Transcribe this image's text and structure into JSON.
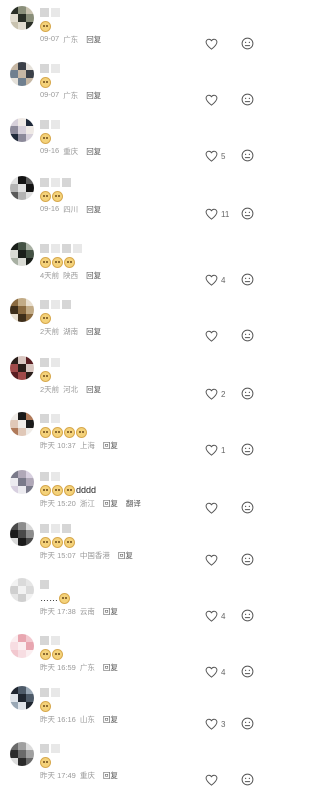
{
  "labels": {
    "reply": "回复",
    "translate": "翻译"
  },
  "colors": {
    "background": "#ffffff",
    "meta": "#9a9a9a",
    "emoji": "#f4d27a"
  },
  "icons": {
    "like": "heart-outline-icon",
    "dislike": "unhappy-face-icon"
  },
  "comments": [
    {
      "content": "",
      "emojis": 1,
      "time": "09-07",
      "location": "广东",
      "likes": "",
      "translate": false
    },
    {
      "content": "",
      "emojis": 1,
      "time": "09-07",
      "location": "广东",
      "likes": "",
      "translate": false
    },
    {
      "content": "",
      "emojis": 1,
      "time": "09-16",
      "location": "重庆",
      "likes": "5",
      "translate": false
    },
    {
      "content": "",
      "emojis": 2,
      "time": "09-16",
      "location": "四川",
      "likes": "11",
      "translate": false
    },
    {
      "content": "",
      "emojis": 3,
      "time": "4天前",
      "location": "陕西",
      "likes": "4",
      "translate": false
    },
    {
      "content": "",
      "emojis": 1,
      "time": "2天前",
      "location": "湖南",
      "likes": "",
      "translate": false
    },
    {
      "content": "",
      "emojis": 1,
      "time": "2天前",
      "location": "河北",
      "likes": "2",
      "translate": false
    },
    {
      "content": "",
      "emojis": 4,
      "time": "昨天 10:37",
      "location": "上海",
      "likes": "1",
      "translate": false
    },
    {
      "content": "dddd",
      "emojis": 3,
      "time": "昨天 15:20",
      "location": "浙江",
      "likes": "",
      "translate": true
    },
    {
      "content": "",
      "emojis": 3,
      "time": "昨天 15:07",
      "location": "中国香港",
      "likes": "",
      "translate": false
    },
    {
      "content": "……",
      "emojis": 1,
      "time": "昨天 17:38",
      "location": "云南",
      "likes": "4",
      "translate": false
    },
    {
      "content": "",
      "emojis": 2,
      "time": "昨天 16:59",
      "location": "广东",
      "likes": "4",
      "translate": false
    },
    {
      "content": "",
      "emojis": 1,
      "time": "昨天 16:16",
      "location": "山东",
      "likes": "3",
      "translate": false
    },
    {
      "content": "",
      "emojis": 1,
      "time": "昨天 17:49",
      "location": "重庆",
      "likes": "",
      "translate": false
    }
  ]
}
